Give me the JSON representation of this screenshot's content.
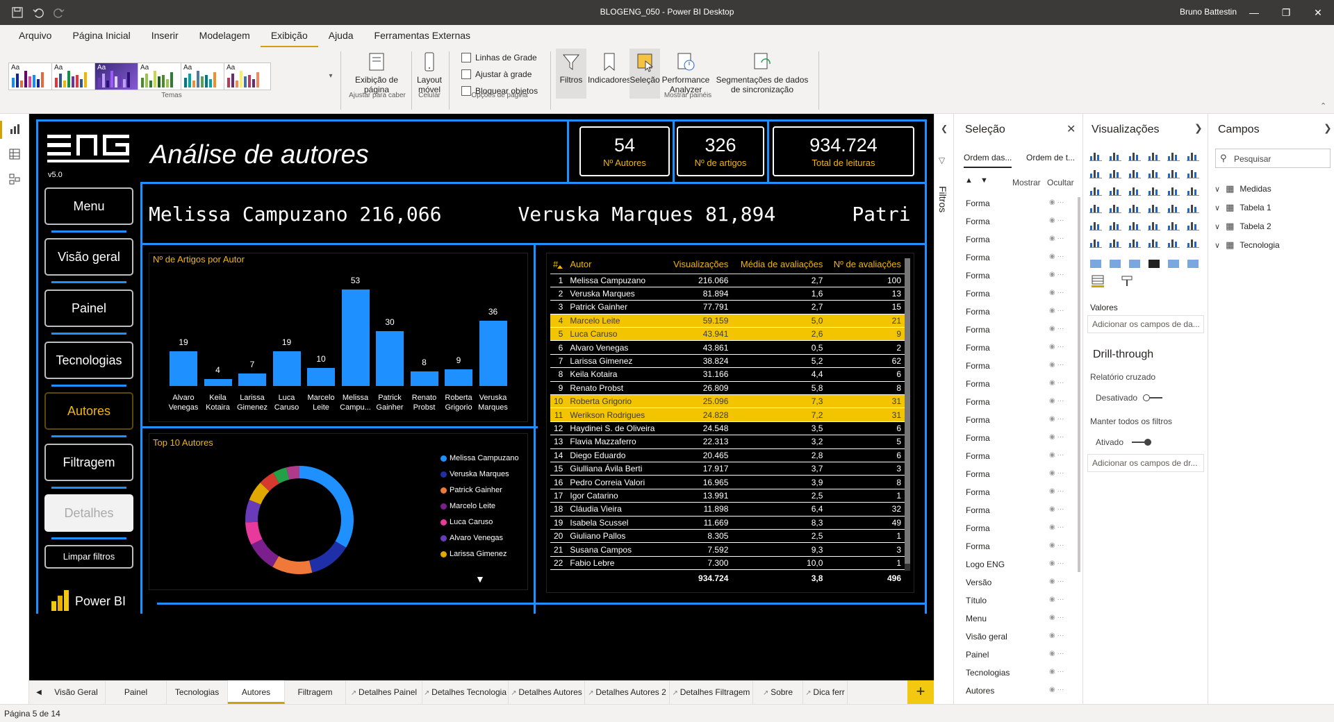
{
  "window": {
    "title": "BLOGENG_050 - Power BI Desktop",
    "user": "Bruno Battestin"
  },
  "ribbon_tabs": [
    "Arquivo",
    "Página Inicial",
    "Inserir",
    "Modelagem",
    "Exibição",
    "Ajuda",
    "Ferramentas Externas"
  ],
  "ribbon": {
    "theme_label": "Aa",
    "group_temas": "Temas",
    "exibicao_pagina": "Exibição de página",
    "group_ajustar": "Ajustar para caber",
    "layout_movel": "Layout móvel",
    "group_celular": "Celular",
    "linhas_grade": "Linhas de Grade",
    "ajustar_grade": "Ajustar à grade",
    "bloquear": "Bloquear objetos",
    "group_opcoes": "Opções de página",
    "filtros": "Filtros",
    "indicadores": "Indicadores",
    "selecao": "Seleção",
    "performance": "Performance Analyzer",
    "segmentacoes": "Segmentações de dados de sincronização",
    "group_paineis": "Mostrar painéis"
  },
  "report": {
    "logo": "ENG",
    "version": "v5.0",
    "title": "Análise de autores",
    "kpis": [
      {
        "value": "54",
        "label": "Nº Autores"
      },
      {
        "value": "326",
        "label": "Nº de artigos"
      },
      {
        "value": "934.724",
        "label": "Total de leituras"
      }
    ],
    "nav": [
      "Menu",
      "Visão geral",
      "Painel",
      "Tecnologias",
      "Autores",
      "Filtragem",
      "Detalhes"
    ],
    "limpar": "Limpar filtros",
    "powerbi": "Power BI",
    "ticker": [
      "Melissa Campuzano 216,066",
      "Veruska Marques 81,894",
      "Patri"
    ],
    "bar_title": "Nº de Artigos por Autor",
    "donut_title": "Top 10 Autores",
    "table": {
      "headers": [
        "#",
        "Autor",
        "Visualizações",
        "Média de avaliações",
        "Nº de avaliações"
      ],
      "rows": [
        [
          "1",
          "Melissa Campuzano",
          "216.066",
          "2,7",
          "100"
        ],
        [
          "2",
          "Veruska Marques",
          "81.894",
          "1,6",
          "13"
        ],
        [
          "3",
          "Patrick Gainher",
          "77.791",
          "2,7",
          "15"
        ],
        [
          "4",
          "Marcelo Leite",
          "59.159",
          "5,0",
          "21"
        ],
        [
          "5",
          "Luca Caruso",
          "43.941",
          "2,6",
          "9"
        ],
        [
          "6",
          "Alvaro Venegas",
          "43.861",
          "0,5",
          "2"
        ],
        [
          "7",
          "Larissa Gimenez",
          "38.824",
          "5,2",
          "62"
        ],
        [
          "8",
          "Keila Kotaira",
          "31.166",
          "4,4",
          "6"
        ],
        [
          "9",
          "Renato Probst",
          "26.809",
          "5,8",
          "8"
        ],
        [
          "10",
          "Roberta Grigorio",
          "25.096",
          "7,3",
          "31"
        ],
        [
          "11",
          "Werikson Rodrigues",
          "24.828",
          "7,2",
          "31"
        ],
        [
          "12",
          "Haydinei S. de Oliveira",
          "24.548",
          "3,5",
          "6"
        ],
        [
          "13",
          "Flavia Mazzaferro",
          "22.313",
          "3,2",
          "5"
        ],
        [
          "14",
          "Diego Eduardo",
          "20.465",
          "2,8",
          "6"
        ],
        [
          "15",
          "Giulliana Ávila Berti",
          "17.917",
          "3,7",
          "3"
        ],
        [
          "16",
          "Pedro Correia Valori",
          "16.965",
          "3,9",
          "8"
        ],
        [
          "17",
          "Igor Catarino",
          "13.991",
          "2,5",
          "1"
        ],
        [
          "18",
          "Cláudia Vieira",
          "11.898",
          "6,4",
          "32"
        ],
        [
          "19",
          "Isabela Scussel",
          "11.669",
          "8,3",
          "49"
        ],
        [
          "20",
          "Giuliano Pallos",
          "8.305",
          "2,5",
          "1"
        ],
        [
          "21",
          "Susana Campos",
          "7.592",
          "9,3",
          "3"
        ],
        [
          "22",
          "Fabio Lebre",
          "7.300",
          "10,0",
          "1"
        ]
      ],
      "highlight_rows": [
        4,
        5,
        10,
        11
      ],
      "totals": [
        "",
        "",
        "934.724",
        "3,8",
        "496"
      ]
    }
  },
  "chart_data": [
    {
      "type": "bar",
      "title": "Nº de Artigos por Autor",
      "categories": [
        "Alvaro Venegas",
        "Keila Kotaira",
        "Larissa Gimenez",
        "Luca Caruso",
        "Marcelo Leite",
        "Melissa Campu...",
        "Patrick Gainher",
        "Renato Probst",
        "Roberta Grigorio",
        "Veruska Marques"
      ],
      "values": [
        19,
        4,
        7,
        19,
        10,
        53,
        30,
        8,
        9,
        36
      ],
      "color": "#1e90ff",
      "ylim": [
        0,
        55
      ]
    },
    {
      "type": "pie",
      "title": "Top 10 Autores",
      "donut": true,
      "legend": [
        "Melissa Campuzano",
        "Veruska Marques",
        "Patrick Gainher",
        "Marcelo Leite",
        "Luca Caruso",
        "Alvaro Venegas",
        "Larissa Gimenez"
      ],
      "values": [
        216066,
        81894,
        77791,
        59159,
        43941,
        43861,
        38824,
        31166,
        26809,
        25096
      ],
      "colors": [
        "#1e90ff",
        "#1f2fa8",
        "#f07838",
        "#7a1f8c",
        "#e8399c",
        "#6a3bb8",
        "#e0a800",
        "#d63a2f",
        "#24a148",
        "#b03a8a"
      ],
      "legend_position": "right"
    }
  ],
  "panes": {
    "selecao": {
      "title": "Seleção",
      "order1": "Ordem das...",
      "order2": "Ordem de t...",
      "mostrar": "Mostrar",
      "ocultar": "Ocultar",
      "items": [
        "Forma",
        "Forma",
        "Forma",
        "Forma",
        "Forma",
        "Forma",
        "Forma",
        "Forma",
        "Forma",
        "Forma",
        "Forma",
        "Forma",
        "Forma",
        "Forma",
        "Forma",
        "Forma",
        "Forma",
        "Forma",
        "Forma",
        "Forma",
        "Logo ENG",
        "Versão",
        "Título",
        "Menu",
        "Visão geral",
        "Painel",
        "Tecnologias",
        "Autores"
      ]
    },
    "filtros_label": "Filtros",
    "viz": {
      "title": "Visualizações",
      "valores": "Valores",
      "add_fields": "Adicionar os campos de da...",
      "drill": "Drill-through",
      "cross": "Relatório cruzado",
      "desativado": "Desativado",
      "manter": "Manter todos os filtros",
      "ativado": "Ativado",
      "add_drill": "Adicionar os campos de dr..."
    },
    "campos": {
      "title": "Campos",
      "search": "Pesquisar",
      "tables": [
        "Medidas",
        "Tabela 1",
        "Tabela 2",
        "Tecnologia"
      ]
    }
  },
  "page_tabs": [
    "Visão Geral",
    "Painel",
    "Tecnologias",
    "Autores",
    "Filtragem",
    "Detalhes Painel",
    "Detalhes Tecnologia",
    "Detalhes Autores",
    "Detalhes Autores 2",
    "Detalhes Filtragem",
    "Sobre",
    "Dica ferr"
  ],
  "active_page_tab": "Autores",
  "status": "Página 5 de 14"
}
